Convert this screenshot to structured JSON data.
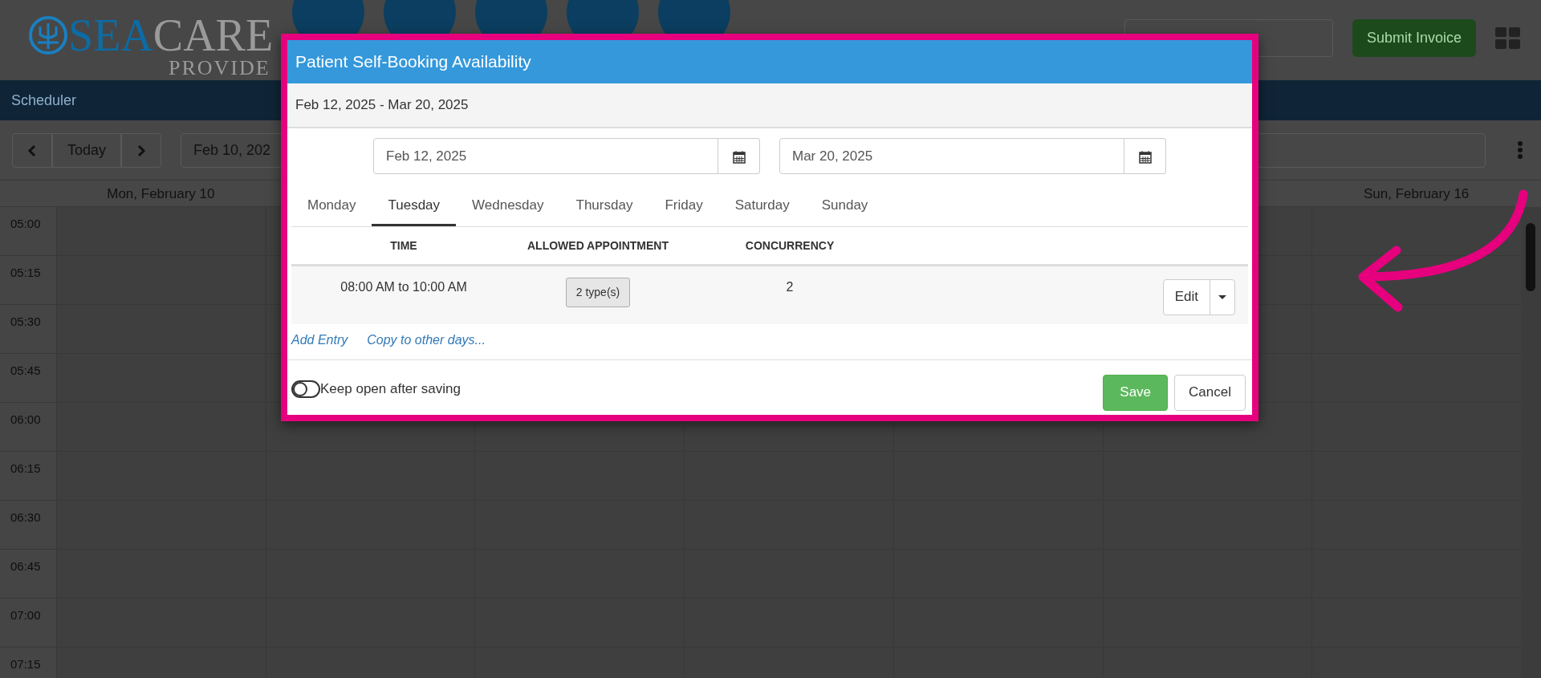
{
  "app": {
    "logo": {
      "part_1": "SEA",
      "part_2": "CARE",
      "subtitle": "PROVIDE"
    },
    "submit_button": "Submit Invoice",
    "nav_title": "Scheduler",
    "today_button": "Today",
    "date_field": "Feb 10, 202",
    "day_headers": [
      "Mon, February 10",
      "Sun, February 16"
    ],
    "times": [
      "05:00",
      "05:15",
      "05:30",
      "05:45",
      "06:00",
      "06:15",
      "06:30",
      "06:45",
      "07:00",
      "07:15"
    ]
  },
  "dialog": {
    "title": "Patient Self-Booking Availability",
    "range": "Feb 12, 2025 - Mar 20, 2025",
    "start_date": "Feb 12, 2025",
    "end_date": "Mar 20, 2025",
    "tabs": [
      {
        "label": "Monday",
        "selected": false
      },
      {
        "label": "Tuesday",
        "selected": true
      },
      {
        "label": "Wednesday",
        "selected": false
      },
      {
        "label": "Thursday",
        "selected": false
      },
      {
        "label": "Friday",
        "selected": false
      },
      {
        "label": "Saturday",
        "selected": false
      },
      {
        "label": "Sunday",
        "selected": false
      }
    ],
    "columns": [
      "TIME",
      "ALLOWED APPOINTMENT",
      "CONCURRENCY"
    ],
    "rows": [
      {
        "time": "08:00 AM to 10:00 AM",
        "types": "2 type(s)",
        "concurrency": "2",
        "action": "Edit"
      }
    ],
    "links": [
      "Add Entry",
      "Copy to other days..."
    ],
    "keep_open": {
      "label": "Keep open after saving",
      "on": false
    },
    "buttons": [
      {
        "label": "Save",
        "kind": "primary"
      },
      {
        "label": "Cancel",
        "kind": "default"
      }
    ]
  }
}
